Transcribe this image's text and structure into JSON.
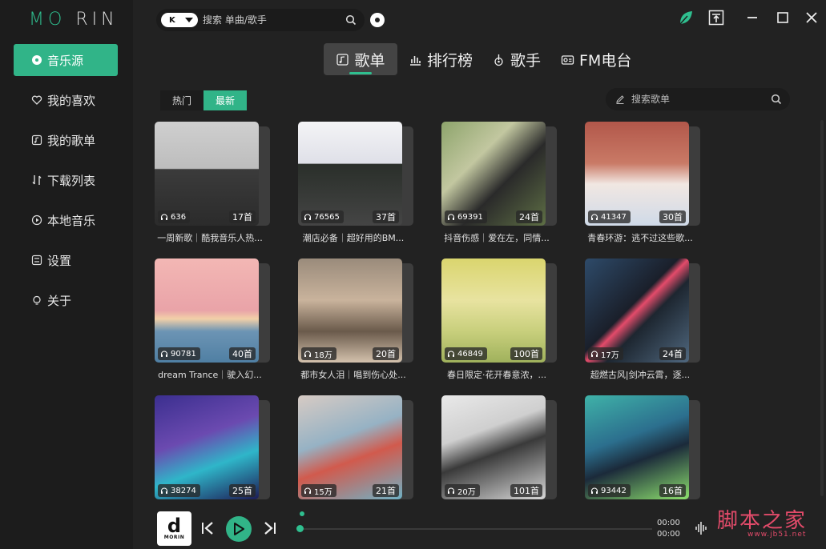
{
  "app": {
    "logo_left": "MO",
    "logo_right": "RIN",
    "accent": "#31b488"
  },
  "sidebar": {
    "items": [
      {
        "label": "音乐源",
        "icon": "disc-icon",
        "active": true
      },
      {
        "label": "我的喜欢",
        "icon": "heart-icon"
      },
      {
        "label": "我的歌单",
        "icon": "playlist-icon"
      },
      {
        "label": "下载列表",
        "icon": "download-icon"
      },
      {
        "label": "本地音乐",
        "icon": "play-circle-icon"
      },
      {
        "label": "设置",
        "icon": "settings-icon"
      },
      {
        "label": "关于",
        "icon": "bulb-icon"
      }
    ]
  },
  "topbar": {
    "source": "K",
    "search_placeholder": "搜索 单曲/歌手"
  },
  "tabs": [
    {
      "label": "歌单",
      "icon": "playlist-tab-icon",
      "active": true
    },
    {
      "label": "排行榜",
      "icon": "chart-icon"
    },
    {
      "label": "歌手",
      "icon": "singer-icon"
    },
    {
      "label": "FM电台",
      "icon": "radio-icon"
    }
  ],
  "filters": {
    "hot": "热门",
    "latest": "最新"
  },
  "playlist_search_placeholder": "搜索歌单",
  "playlists": [
    {
      "title": "一周新歌｜酷我音乐人热...",
      "plays": "636",
      "count": "17首"
    },
    {
      "title": "潮店必备｜超好用的BM...",
      "plays": "76565",
      "count": "37首"
    },
    {
      "title": "抖音伤感｜爱在左，同情...",
      "plays": "69391",
      "count": "24首"
    },
    {
      "title": "青春环游：逃不过这些歌...",
      "plays": "41347",
      "count": "30首"
    },
    {
      "title": "dream Trance｜驶入幻...",
      "plays": "90781",
      "count": "40首"
    },
    {
      "title": "都市女人泪｜唱到伤心处...",
      "plays": "18万",
      "count": "20首"
    },
    {
      "title": "春日限定·花开春意浓，...",
      "plays": "46849",
      "count": "100首"
    },
    {
      "title": "超燃古风|剑冲云霄，逐...",
      "plays": "17万",
      "count": "24首"
    },
    {
      "title": "",
      "plays": "38274",
      "count": "25首"
    },
    {
      "title": "",
      "plays": "15万",
      "count": "21首"
    },
    {
      "title": "",
      "plays": "20万",
      "count": "101首"
    },
    {
      "title": "",
      "plays": "93442",
      "count": "16首"
    }
  ],
  "player": {
    "album_letter": "d",
    "album_brand": "MORIN",
    "time_current": "00:00",
    "time_total": "00:00",
    "progress": 0
  },
  "watermark": {
    "text": "脚本之家",
    "url": "www.jb51.net"
  }
}
